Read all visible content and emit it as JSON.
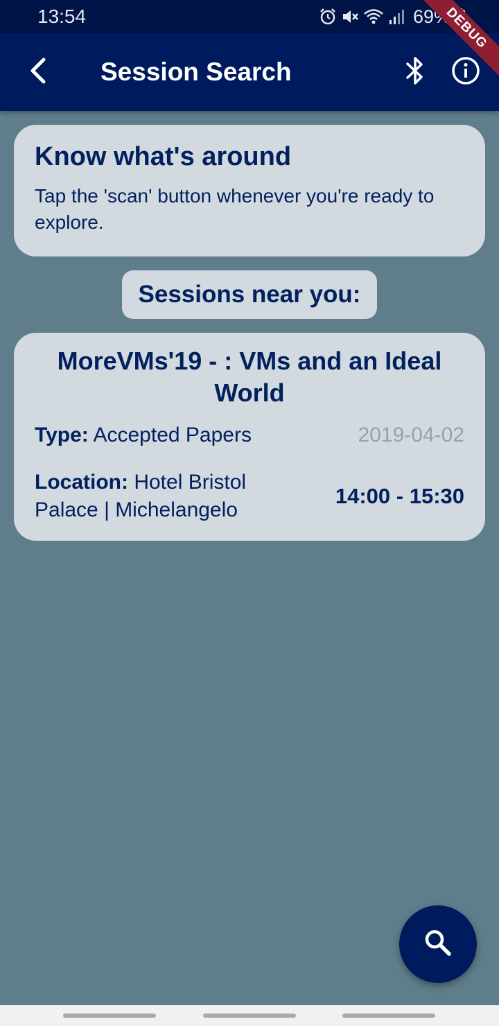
{
  "status_bar": {
    "time": "13:54",
    "battery": "69%",
    "icons": [
      "alarm-icon",
      "mute-icon",
      "wifi-icon",
      "signal-icon",
      "battery-icon"
    ]
  },
  "debug_banner": "DEBUG",
  "app_bar": {
    "title": "Session Search",
    "icons": [
      "back-arrow-icon",
      "bluetooth-icon",
      "info-icon"
    ]
  },
  "intro": {
    "title": "Know what's around",
    "text": "Tap the 'scan' button whenever you're ready to explore."
  },
  "section_label": "Sessions near you:",
  "session": {
    "title": "MoreVMs'19 - : VMs and an Ideal World",
    "type_label": "Type:",
    "type_value": " Accepted Papers",
    "date": "2019-04-02",
    "location_label": "Location:",
    "location_value": " Hotel Bristol Palace | Michelangelo",
    "time": "14:00 - 15:30"
  },
  "fab": {
    "icon": "search-icon"
  },
  "colors": {
    "background": "#607d8b",
    "app_bar": "#001a5e",
    "status_bar": "#001447",
    "card": "#d2d9df",
    "text_primary": "#00205e",
    "text_muted": "#9aa0a6",
    "debug_ribbon": "#8e1f33"
  }
}
